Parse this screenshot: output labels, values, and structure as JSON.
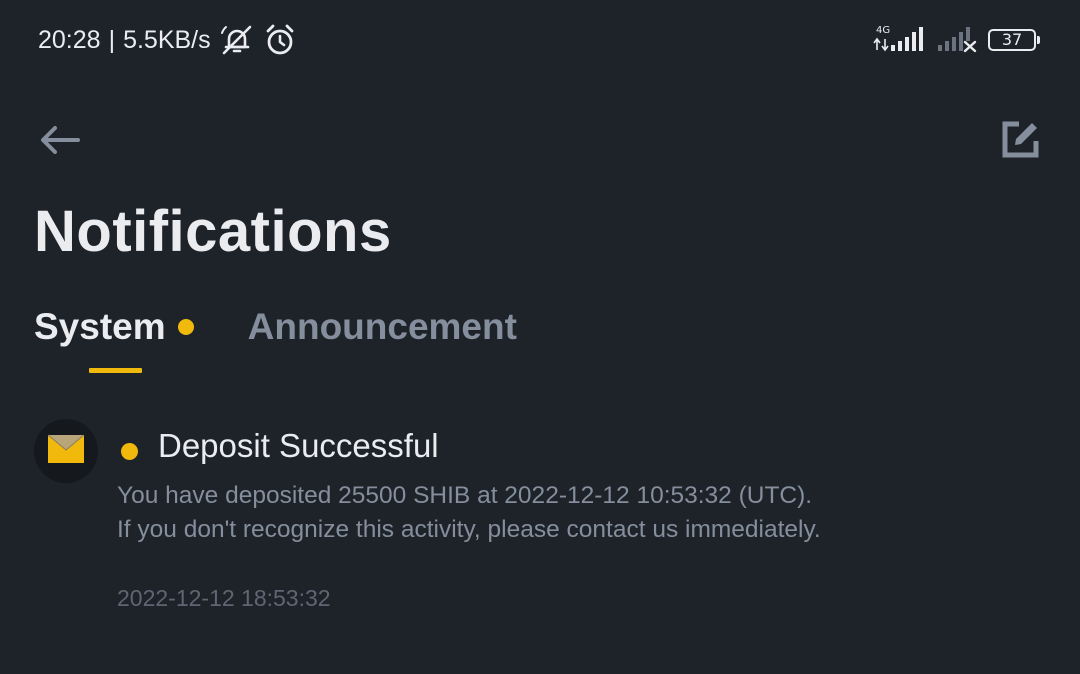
{
  "status_bar": {
    "time": "20:28",
    "separator": "|",
    "network_speed": "5.5KB/s",
    "network_type": "4G",
    "battery_level": "37",
    "icons": [
      "bell-muted-icon",
      "alarm-icon",
      "signal-4g-icon",
      "signal-no-service-icon",
      "battery-icon"
    ]
  },
  "nav": {
    "back_icon": "arrow-left-icon",
    "edit_icon": "edit-icon"
  },
  "page": {
    "title": "Notifications"
  },
  "tabs": [
    {
      "label": "System",
      "active": true,
      "has_unread": true
    },
    {
      "label": "Announcement",
      "active": false,
      "has_unread": false
    }
  ],
  "notifications": [
    {
      "icon": "envelope-icon",
      "unread": true,
      "title": "Deposit Successful",
      "body_line_1": "You have deposited 25500 SHIB at 2022-12-12 10:53:32 (UTC).",
      "body_line_2": "If you don't recognize this activity, please contact us immediately.",
      "timestamp": "2022-12-12 18:53:32"
    }
  ],
  "colors": {
    "background": "#1e2329",
    "accent": "#f0b90b",
    "text_primary": "#eaecef",
    "text_secondary": "#848e9c",
    "text_tertiary": "#5e6673"
  }
}
